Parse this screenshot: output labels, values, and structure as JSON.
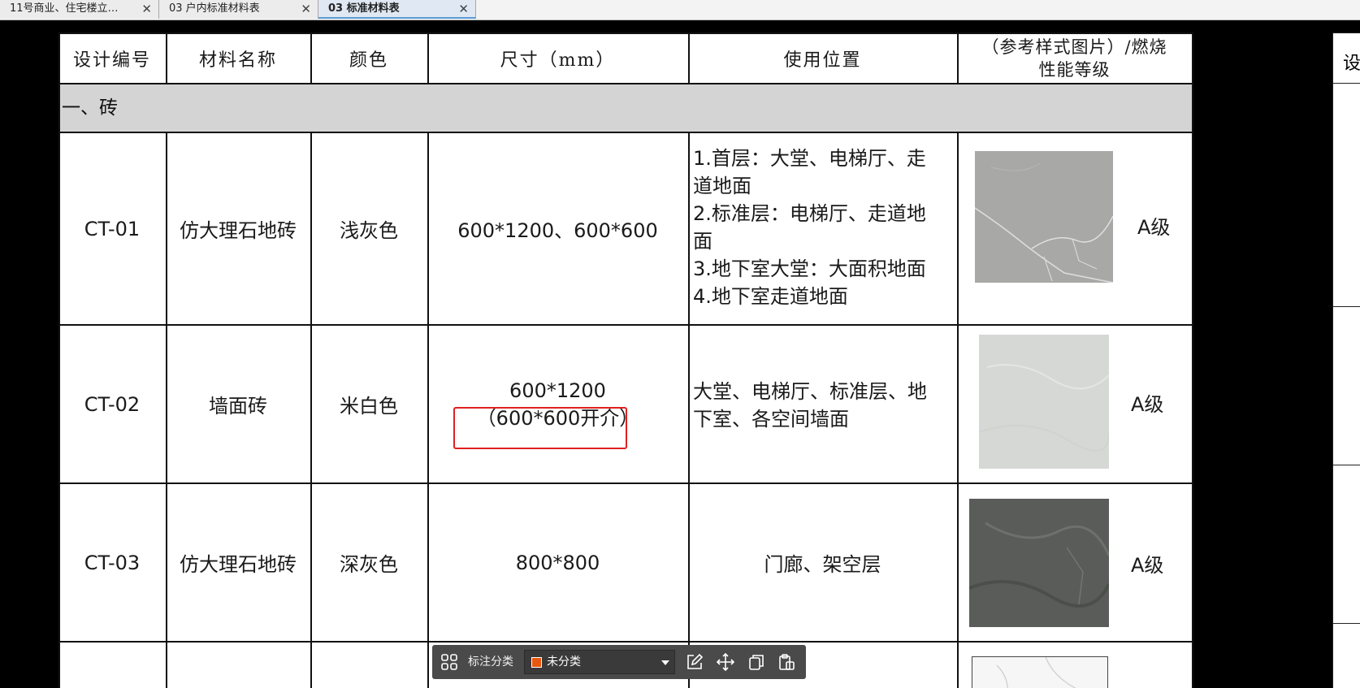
{
  "tabs": [
    {
      "label": "11号商业、住宅楼立…",
      "close": "✕"
    },
    {
      "label": "03 户内标准材料表",
      "close": "✕"
    },
    {
      "label": "03 标准材料表",
      "close": "✕"
    }
  ],
  "table": {
    "headers": [
      "设计编号",
      "材料名称",
      "颜色",
      "尺寸（mm）",
      "使用位置",
      "（参考样式图片）/燃烧",
      "性能等级"
    ],
    "section": "一、砖",
    "rows": [
      {
        "code": "CT-01",
        "name": "仿大理石地砖",
        "color": "浅灰色",
        "size_line1": "600*1200、600*600",
        "size_line2": "",
        "usage": "1.首层：大堂、电梯厅、走\n道地面\n2.标准层：电梯厅、走道地\n面\n3.地下室大堂：大面积地面\n4.地下室走道地面",
        "grade": "A级",
        "swatch_color": "#a8a9a7"
      },
      {
        "code": "CT-02",
        "name": "墙面砖",
        "color": "米白色",
        "size_line1": "600*1200",
        "size_line2": "（600*600开介）",
        "usage": "大堂、电梯厅、标准层、地\n下室、各空间墙面",
        "grade": "A级",
        "swatch_color": "#d6d8d5"
      },
      {
        "code": "CT-03",
        "name": "仿大理石地砖",
        "color": "深灰色",
        "size_line1": "800*800",
        "size_line2": "",
        "usage": "门廊、架空层",
        "grade": "A级",
        "swatch_color": "#5a5c5a"
      }
    ],
    "right_panel_header": "设"
  },
  "toolbar": {
    "label": "标注分类",
    "select_value": "未分类",
    "select_swatch_color": "#e8570e",
    "icons": [
      "grid-icon",
      "edit-icon",
      "move-icon",
      "copy-icon",
      "paste-icon"
    ]
  },
  "colors": {
    "highlight": "#e02020",
    "section_bg": "#d4d4d4",
    "toolbar_bg": "#4a4a4a"
  }
}
